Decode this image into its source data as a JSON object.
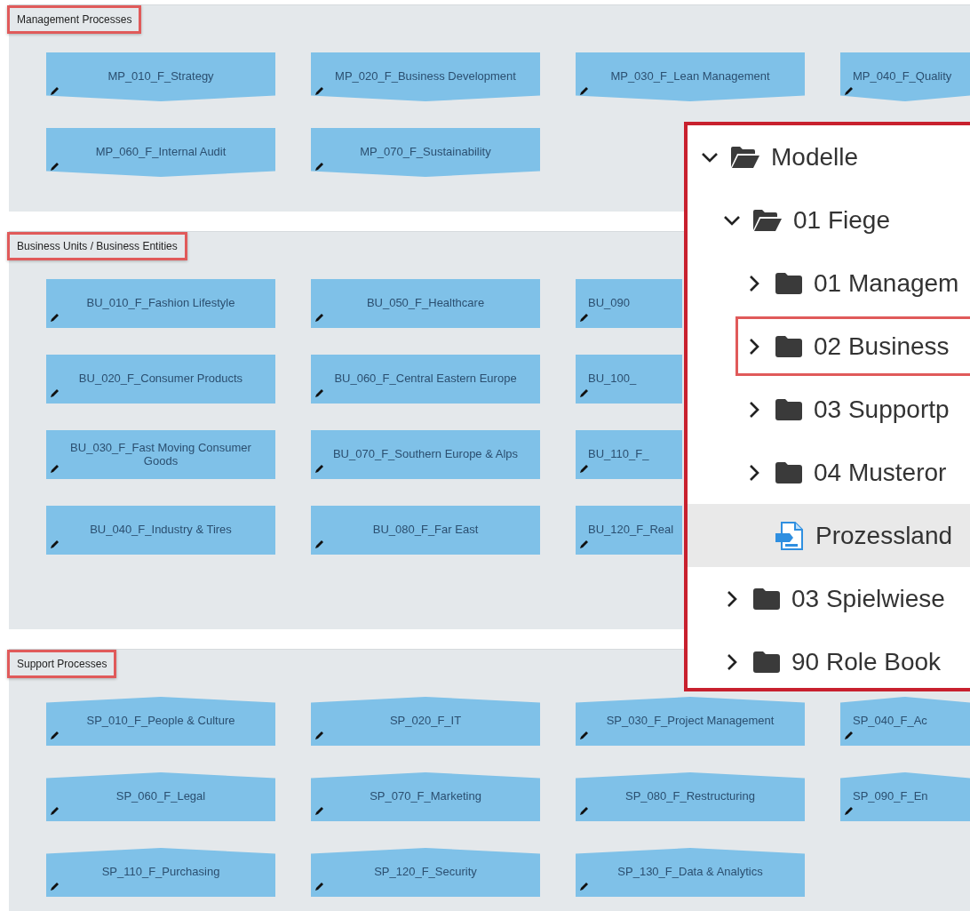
{
  "sections": [
    {
      "title": "Management Processes",
      "kind": "chevron",
      "rows": [
        [
          {
            "label": "MP_010_F_Strategy",
            "cut": false
          },
          {
            "label": "MP_020_F_Business Development",
            "cut": false
          },
          {
            "label": "MP_030_F_Lean Management",
            "cut": false
          },
          {
            "label": "MP_040_F_Quality",
            "cut": true
          }
        ],
        [
          {
            "label": "MP_060_F_Internal Audit",
            "cut": false
          },
          {
            "label": "MP_070_F_Sustainability",
            "cut": false
          }
        ]
      ]
    },
    {
      "title": "Business Units / Business Entities",
      "kind": "rect",
      "rows": [
        [
          {
            "label": "BU_010_F_Fashion Lifestyle",
            "cut": false
          },
          {
            "label": "BU_050_F_Healthcare",
            "cut": false
          },
          {
            "label": "BU_090",
            "cut": true
          }
        ],
        [
          {
            "label": "BU_020_F_Consumer Products",
            "cut": false
          },
          {
            "label": "BU_060_F_Central Eastern Europe",
            "cut": false
          },
          {
            "label": "BU_100_",
            "cut": true
          }
        ],
        [
          {
            "label": "BU_030_F_Fast Moving Consumer Goods",
            "cut": false
          },
          {
            "label": "BU_070_F_Southern Europe & Alps",
            "cut": false
          },
          {
            "label": "BU_110_F_",
            "cut": true
          }
        ],
        [
          {
            "label": "BU_040_F_Industry & Tires",
            "cut": false
          },
          {
            "label": "BU_080_F_Far East",
            "cut": false
          },
          {
            "label": "BU_120_F_Real",
            "cut": true
          }
        ]
      ]
    },
    {
      "title": "Support Processes",
      "kind": "peak",
      "rows": [
        [
          {
            "label": "SP_010_F_People & Culture",
            "cut": false
          },
          {
            "label": "SP_020_F_IT",
            "cut": false
          },
          {
            "label": "SP_030_F_Project Management",
            "cut": false
          },
          {
            "label": "SP_040_F_Ac",
            "cut": true
          }
        ],
        [
          {
            "label": "SP_060_F_Legal",
            "cut": false
          },
          {
            "label": "SP_070_F_Marketing",
            "cut": false
          },
          {
            "label": "SP_080_F_Restructuring",
            "cut": false
          },
          {
            "label": "SP_090_F_En",
            "cut": true
          }
        ],
        [
          {
            "label": "SP_110_F_Purchasing",
            "cut": false
          },
          {
            "label": "SP_120_F_Security",
            "cut": false
          },
          {
            "label": "SP_130_F_Data & Analytics",
            "cut": false
          }
        ]
      ]
    }
  ],
  "tree": [
    {
      "label": "Modelle",
      "kind": "folder",
      "expanded": true,
      "selected": false,
      "highlighted": false,
      "children": [
        {
          "label": "01 Fiege",
          "kind": "folder",
          "expanded": true,
          "selected": false,
          "highlighted": false,
          "children": [
            {
              "label": "01 Managem",
              "kind": "folder",
              "expanded": false,
              "selected": false,
              "highlighted": false
            },
            {
              "label": "02 Business",
              "kind": "folder",
              "expanded": false,
              "selected": false,
              "highlighted": true
            },
            {
              "label": "03 Supportp",
              "kind": "folder",
              "expanded": false,
              "selected": false,
              "highlighted": false
            },
            {
              "label": "04 Musteror",
              "kind": "folder",
              "expanded": false,
              "selected": false,
              "highlighted": false
            },
            {
              "label": "Prozessland",
              "kind": "document",
              "selected": true,
              "highlighted": false
            }
          ]
        },
        {
          "label": "03 Spielwiese",
          "kind": "folder",
          "expanded": false,
          "selected": false,
          "highlighted": false
        },
        {
          "label": "90 Role Book",
          "kind": "folder",
          "expanded": false,
          "selected": false,
          "highlighted": false
        }
      ]
    }
  ]
}
